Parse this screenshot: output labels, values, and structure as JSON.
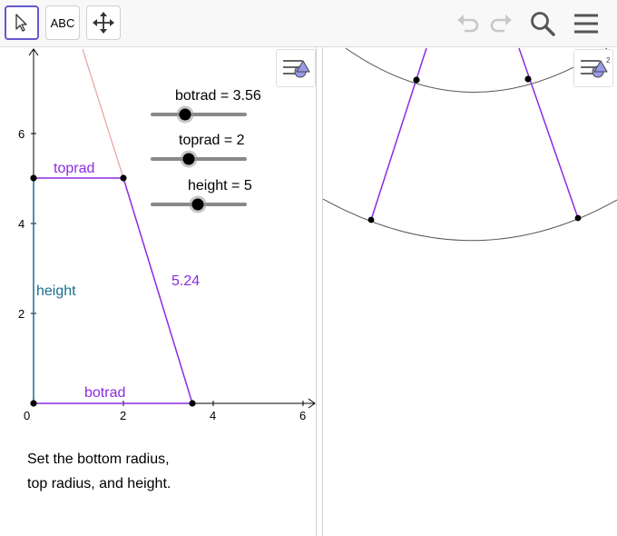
{
  "toolbar": {
    "tools": [
      {
        "name": "move-tool",
        "icon": "cursor-arrow-icon",
        "active": true
      },
      {
        "name": "text-tool",
        "label": "ABC"
      },
      {
        "name": "move-graphics-tool",
        "icon": "move-arrows-icon"
      }
    ],
    "actions": [
      "undo-icon",
      "redo-icon",
      "search-icon",
      "hamburger-menu-icon"
    ]
  },
  "sliders": {
    "botrad": {
      "label": "botrad = 3.56",
      "value": 3.56
    },
    "toprad": {
      "label": "toprad = 2",
      "value": 2
    },
    "height": {
      "label": "height = 5",
      "value": 5
    }
  },
  "graphics": {
    "x_ticks": [
      "0",
      "2",
      "4",
      "6"
    ],
    "y_ticks": [
      "2",
      "4",
      "6"
    ],
    "segment_labels": {
      "toprad": "toprad",
      "botrad": "botrad",
      "height": "height",
      "slant": "5.24"
    },
    "colors": {
      "purple": "#8a2be2",
      "teal": "#1a6e8e",
      "pink": "#e9a0a0",
      "axis": "#000000"
    }
  },
  "description": {
    "line1": "Set the bottom radius,",
    "line2": "top radius, and height."
  }
}
